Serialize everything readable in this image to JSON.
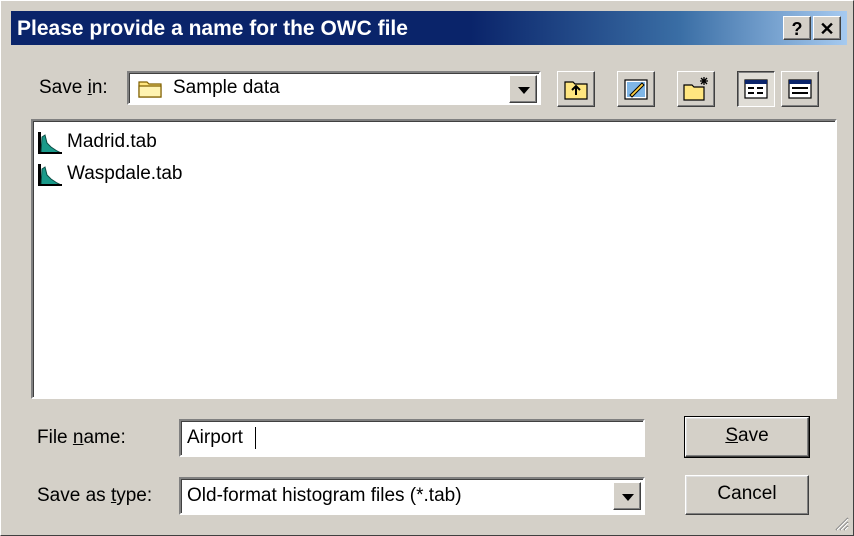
{
  "title": "Please provide a name for the OWC file",
  "titlebar_buttons": {
    "help": "?",
    "close": "✕"
  },
  "save_in": {
    "label_prefix": "Save ",
    "label_accel": "i",
    "label_suffix": "n:",
    "value": "Sample data"
  },
  "toolbar": {
    "up": "up-one-level-icon",
    "desktop": "desktop-icon",
    "new_folder": "new-folder-icon",
    "list": "list-view-icon",
    "details": "details-view-icon"
  },
  "files": [
    {
      "name": "Madrid.tab",
      "icon": "histogram-file-icon"
    },
    {
      "name": "Waspdale.tab",
      "icon": "histogram-file-icon"
    }
  ],
  "file_name": {
    "label_prefix": "File ",
    "label_accel": "n",
    "label_suffix": "ame:",
    "value": "Airport"
  },
  "save_as_type": {
    "label_prefix": "Save as ",
    "label_accel": "t",
    "label_suffix": "ype:",
    "value": "Old-format histogram files (*.tab)"
  },
  "buttons": {
    "save_accel": "S",
    "save_rest": "ave",
    "cancel": "Cancel"
  },
  "colors": {
    "titlebar": "#0a246a",
    "face": "#d4d0c8"
  }
}
